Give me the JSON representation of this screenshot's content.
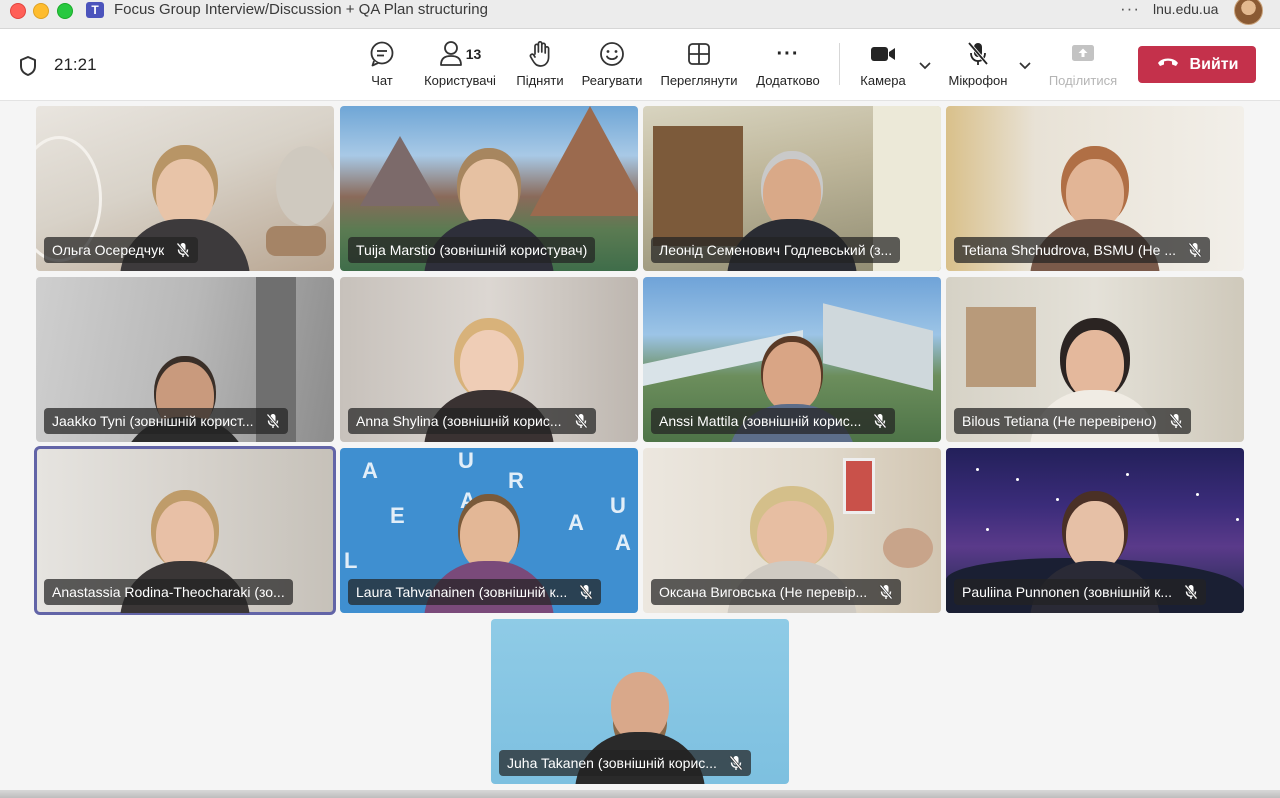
{
  "window": {
    "title": "Focus Group Interview/Discussion + QA Plan structuring",
    "app_icon_label": "T",
    "more": "···",
    "org": "lnu.edu.ua"
  },
  "toolbar": {
    "time": "21:21",
    "chat": "Чат",
    "people": "Користувачі",
    "people_count": "13",
    "raise_hand": "Підняти",
    "react": "Реагувати",
    "view": "Переглянути",
    "more": "Додатково",
    "more_glyph": "···",
    "camera": "Камера",
    "mic": "Мікрофон",
    "share": "Поділитися",
    "leave": "Вийти"
  },
  "participants": [
    {
      "name": "Ольга Осередчук"
    },
    {
      "name": "Tuija Marstio (зовнішній користувач)"
    },
    {
      "name": "Леонід Семенович Годлевський (з..."
    },
    {
      "name": "Tetiana Shchudrova, BSMU (Не ..."
    },
    {
      "name": "Jaakko Tyni (зовнішній корист..."
    },
    {
      "name": "Anna Shylina (зовнішній корис..."
    },
    {
      "name": "Anssi Mattila (зовнішній корис..."
    },
    {
      "name": "Bilous Tetiana (Не перевірено)"
    },
    {
      "name": "Anastassia Rodina-Theocharaki (зо..."
    },
    {
      "name": "Laura Tahvanainen (зовнішній к..."
    },
    {
      "name": "Оксана Виговська (Не перевір..."
    },
    {
      "name": "Pauliina Punnonen (зовнішній к..."
    },
    {
      "name": "Juha Takanen (зовнішній корис..."
    }
  ],
  "colors": {
    "accent": "#6264a7",
    "leave": "#c4314b"
  }
}
